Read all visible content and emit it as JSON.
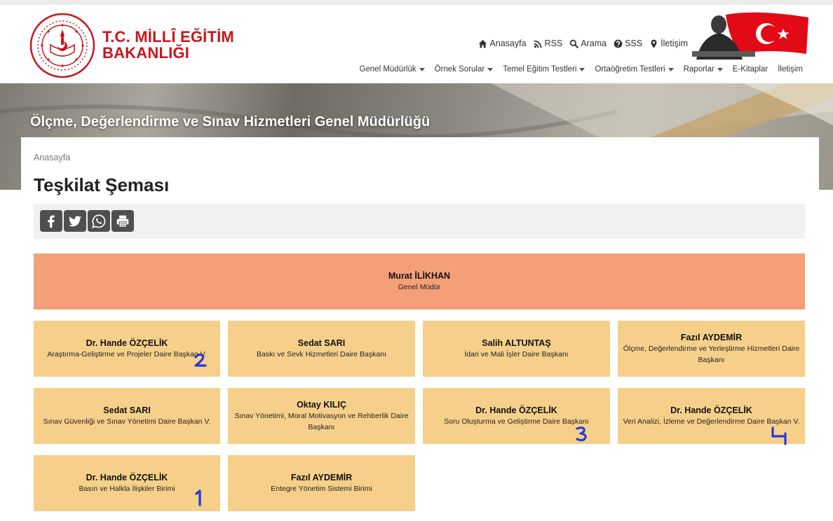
{
  "brand": {
    "line1": "T.C. MİLLÎ EĞİTİM",
    "line2": "BAKANLIĞI"
  },
  "toplinks": [
    {
      "label": "Anasayfa",
      "icon": "home-icon"
    },
    {
      "label": "RSS",
      "icon": "rss-icon"
    },
    {
      "label": "Arama",
      "icon": "search-icon"
    },
    {
      "label": "SSS",
      "icon": "question-icon"
    },
    {
      "label": "İletişim",
      "icon": "map-marker-icon"
    }
  ],
  "mainnav": [
    {
      "label": "Genel Müdürlük",
      "dropdown": true
    },
    {
      "label": "Örnek Sorular",
      "dropdown": true
    },
    {
      "label": "Temel Eğitim Testleri",
      "dropdown": true
    },
    {
      "label": "Ortaöğretim Testleri",
      "dropdown": true
    },
    {
      "label": "Raporlar",
      "dropdown": true
    },
    {
      "label": "E-Kitaplar",
      "dropdown": false
    },
    {
      "label": "İletişim",
      "dropdown": false
    }
  ],
  "banner": {
    "title": "Ölçme, Değerlendirme ve Sınav Hizmetleri Genel Müdürlüğü"
  },
  "breadcrumb": "Anasayfa",
  "page_title": "Teşkilat Şeması",
  "share": [
    "facebook-icon",
    "twitter-icon",
    "whatsapp-icon",
    "print-icon"
  ],
  "colors": {
    "brand_red": "#c8161d",
    "head_card": "#f59f78",
    "dept_card": "#f6d08a",
    "annotation_blue": "#2a3bd6"
  },
  "org": {
    "head": {
      "name": "Murat İLİKHAN",
      "role": "Genel Müdür"
    },
    "units": [
      {
        "name": "Dr. Hande ÖZÇELİK",
        "role": "Araştırma-Geliştirme ve Projeler Daire Başkan V."
      },
      {
        "name": "Sedat SARI",
        "role": "Baskı ve Sevk Hizmetleri Daire Başkanı"
      },
      {
        "name": "Salih ALTUNTAŞ",
        "role": "İdari ve Mali İşler Daire Başkanı"
      },
      {
        "name": "Fazıl AYDEMİR",
        "role": "Ölçme, Değerlendirme ve Yerleştirme Hizmetleri Daire Başkanı"
      },
      {
        "name": "Sedat SARI",
        "role": "Sınav Güvenliği ve Sınav Yönetimi Daire Başkan V."
      },
      {
        "name": "Oktay KILIÇ",
        "role": "Sınav Yönetimi, Moral Motivasyon ve Rehberlik Daire Başkanı"
      },
      {
        "name": "Dr. Hande ÖZÇELİK",
        "role": "Soru Oluşturma ve Geliştirme Daire Başkanı"
      },
      {
        "name": "Dr. Hande ÖZÇELİK",
        "role": "Veri Analizi, İzleme ve Değerlendirme Daire Başkan V."
      },
      {
        "name": "Dr. Hande ÖZÇELİK",
        "role": "Basın ve Halkla İlişkiler Birimi"
      },
      {
        "name": "Fazıl AYDEMİR",
        "role": "Entegre Yönetim Sistemi Birimi"
      }
    ]
  },
  "annotations": [
    "2",
    "3",
    "4",
    "1"
  ]
}
